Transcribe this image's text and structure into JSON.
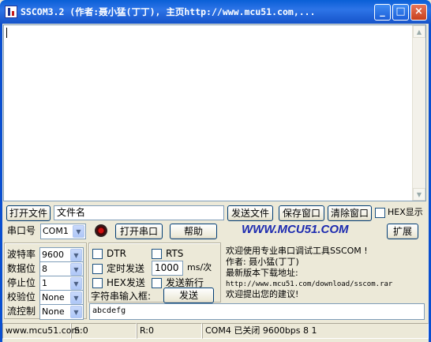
{
  "window": {
    "title": "SSCOM3.2 (作者:聂小猛(丁丁), 主页http://www.mcu51.com,..."
  },
  "toolbar1": {
    "open_file": "打开文件",
    "file_name": "文件名",
    "send_file": "发送文件",
    "save_window": "保存窗口",
    "clear_window": "清除窗口",
    "hex_display": "HEX显示"
  },
  "toolbar2": {
    "port_label": "串口号",
    "port_value": "COM1",
    "open_port": "打开串口",
    "help": "帮助",
    "brand": "WWW.MCU51.COM",
    "expand": "扩展"
  },
  "settings": [
    {
      "label": "波特率",
      "value": "9600"
    },
    {
      "label": "数据位",
      "value": "8"
    },
    {
      "label": "停止位",
      "value": "1"
    },
    {
      "label": "校验位",
      "value": "None"
    },
    {
      "label": "流控制",
      "value": "None"
    }
  ],
  "options": {
    "dtr": "DTR",
    "rts": "RTS",
    "timed_send": "定时发送",
    "interval": "1000",
    "interval_unit": "ms/次",
    "hex_send": "HEX发送",
    "send_newline": "发送新行",
    "input_label": "字符串输入框:",
    "send": "发送"
  },
  "info": {
    "line1": "欢迎使用专业串口调试工具SSCOM !",
    "line2": "作者: 聂小猛(丁丁)",
    "line3": "最新版本下载地址:",
    "line4": "http://www.mcu51.com/download/sscom.rar",
    "line5": "欢迎提出您的建议!"
  },
  "send_text": "abcdefg",
  "status": {
    "site": "www.mcu51.com",
    "sent": "S:0",
    "received": "R:0",
    "port_state": "COM4 已关闭  9600bps  8 1"
  }
}
